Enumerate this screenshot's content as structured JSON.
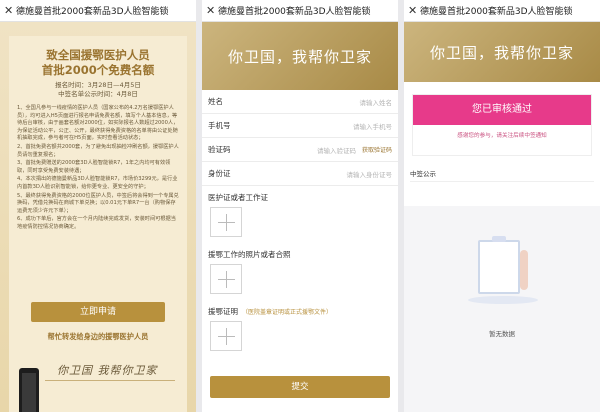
{
  "page_title": "德施曼首批2000套新品3D人脸智能锁",
  "screen1": {
    "heading": [
      "致全国援鄂医护人员",
      "首批2000个免费名额"
    ],
    "meta": [
      "报名时间：3月28日—4月5日",
      "中签名单公示时间：4月8日"
    ],
    "rules": [
      "1、全国凡参与一线疫情的医护人员（国家公布的4.2万名援鄂医护人员），均可进入H5页面进行报名申请免费名额，填写个人基本信息，等待后台审核，由于画套名额对2000位，如实际报名人数超过2000人，为保证活动公平，公正、公开，最终获得免费资格的名单将由公证处随机抽取完成，参与者可在H5页面，实时查看活动状态；",
      "2、首批免费名额共2000套，为了避免出现抽检冲刷名额，援鄂医护人员请勿重复报名；",
      "3、首批免费赠送的2000套3D人脸智能锁R7，1年之内均可有效领取，同时享受免费安装待遇；",
      "4、本次捐出的德施曼新品3D人脸智能锁R7，市场价3299元，是行业内首款3D人脸识别智能锁，给你更专业、更安全的守护；",
      "5、最终获得免费资格的2000位医护人员，中签后将会得到一个专属兑换码，凭借兑换码在商城下单兑换；以0.01元下单R7一台（购物保存运费无须少许元下单）；",
      "6、成功下单后，官方会在一个月内陆续完成发货，安装时间可根据当地疫情防控情况协商确定。"
    ],
    "apply_button": "立即申请",
    "share_text": "帮忙转发给身边的援鄂医护人员",
    "slogan": "你卫国 我帮你卫家"
  },
  "screen2": {
    "hero": "你卫国，我帮你卫家",
    "fields": [
      {
        "label": "姓名",
        "placeholder": "请输入姓名"
      },
      {
        "label": "手机号",
        "placeholder": "请输入手机号"
      },
      {
        "label": "验证码",
        "placeholder": "请输入验证码",
        "action": "获取验证码"
      },
      {
        "label": "身份证",
        "placeholder": "请输入身份证号"
      }
    ],
    "uploads": [
      {
        "label": "医护证或者工作证",
        "note": ""
      },
      {
        "label": "援鄂工作的照片或者合照",
        "note": ""
      },
      {
        "label": "援鄂证明",
        "note": "（医院盖章证明或正式援鄂文件）"
      }
    ],
    "submit": "提交"
  },
  "screen3": {
    "hero": "你卫国，我帮你卫家",
    "status": "您已审核通过",
    "thanks": "感谢您的参与，请关注后续中签通知",
    "public_title": "中签公示",
    "empty_text": "暂无数据"
  },
  "colors": {
    "gold": "#b8913d",
    "pink": "#e73a8a",
    "hero_start": "#ccb57e",
    "hero_end": "#a88a46"
  }
}
